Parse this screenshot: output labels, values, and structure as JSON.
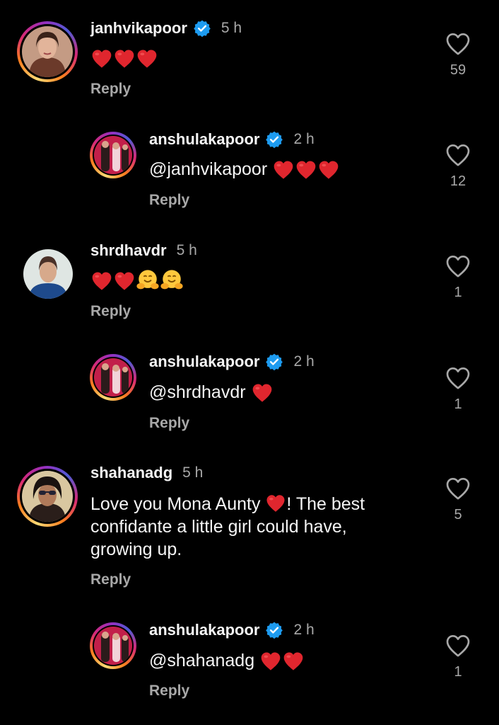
{
  "colors": {
    "background": "#000000",
    "verified": "#1d9bf0",
    "heart": "#e53935",
    "muted": "#a8a8a8"
  },
  "icons": {
    "like": "heart-outline-icon",
    "verified": "verified-badge-icon",
    "emoji_heart": "red-heart-emoji",
    "emoji_hug": "hugging-face-emoji"
  },
  "comments": [
    {
      "username": "janhvikapoor",
      "verified": true,
      "time": "5 h",
      "text": "",
      "emojis": [
        "heart",
        "heart",
        "heart"
      ],
      "reply_label": "Reply",
      "likes": "59"
    },
    {
      "username": "anshulakapoor",
      "verified": true,
      "time": "2 h",
      "text": "@janhvikapoor",
      "emojis": [
        "heart",
        "heart",
        "heart"
      ],
      "reply_label": "Reply",
      "likes": "12"
    },
    {
      "username": "shrdhavdr",
      "verified": false,
      "time": "5 h",
      "text": "",
      "emojis": [
        "heart",
        "heart",
        "hug",
        "hug"
      ],
      "reply_label": "Reply",
      "likes": "1"
    },
    {
      "username": "anshulakapoor",
      "verified": true,
      "time": "2 h",
      "text": "@shrdhavdr",
      "emojis": [
        "heart"
      ],
      "reply_label": "Reply",
      "likes": "1"
    },
    {
      "username": "shahanadg",
      "verified": false,
      "time": "5 h",
      "text_before": "Love you Mona Aunty",
      "text_after": "! The best",
      "text_line2": "confidante a little girl could have,",
      "text_line3": "growing up.",
      "reply_label": "Reply",
      "likes": "5"
    },
    {
      "username": "anshulakapoor",
      "verified": true,
      "time": "2 h",
      "text": "@shahanadg",
      "emojis": [
        "heart",
        "heart"
      ],
      "reply_label": "Reply",
      "likes": "1"
    }
  ]
}
